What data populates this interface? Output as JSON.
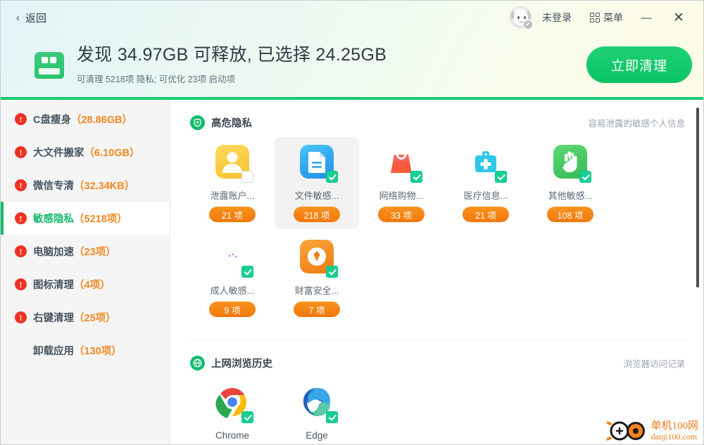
{
  "titlebar": {
    "back_chevron": "‹",
    "back_label": "返回",
    "login_label": "未登录",
    "menu_label": "菜单",
    "minimize_label": "—",
    "close_label": "✕",
    "avatar_badge": "✔"
  },
  "hero": {
    "title": "发现 34.97GB 可释放, 已选择 24.25GB",
    "subtitle": "可清理 5218项 隐私; 可优化 23项 启动项",
    "clean_button": "立即清理",
    "disk_icon": "disk-icon"
  },
  "colors": {
    "accent_green": "#19cb74",
    "badge_orange": "#f4780d",
    "warning_red": "#f03222",
    "sidebar_count": "#f5881f",
    "check_teal": "#18cf93"
  },
  "sidebar": {
    "items": [
      {
        "name": "C盘瘦身",
        "count": "（28.86GB）",
        "warn": true,
        "active": false
      },
      {
        "name": "大文件搬家",
        "count": "（6.10GB）",
        "warn": true,
        "active": false
      },
      {
        "name": "微信专清",
        "count": "（32.34KB）",
        "warn": true,
        "active": false
      },
      {
        "name": "敏感隐私",
        "count": "（5218项）",
        "warn": true,
        "active": true
      },
      {
        "name": "电脑加速",
        "count": "（23项）",
        "warn": true,
        "active": false
      },
      {
        "name": "图标清理",
        "count": "（4项）",
        "warn": true,
        "active": false
      },
      {
        "name": "右键清理",
        "count": "（25项）",
        "warn": true,
        "active": false
      },
      {
        "name": "卸载应用",
        "count": "（130项）",
        "warn": false,
        "active": false
      }
    ],
    "warn_glyph": "!"
  },
  "sections": [
    {
      "id": "high-risk-privacy",
      "icon": "shield-icon",
      "title": "高危隐私",
      "note": "容易泄露的敏感个人信息",
      "tiles": [
        {
          "label": "泄露账户...",
          "badge": "21 项",
          "checked": false,
          "highlighted": false,
          "icon": "account-leak-icon"
        },
        {
          "label": "文件敏感...",
          "badge": "218 项",
          "checked": true,
          "highlighted": true,
          "icon": "document-icon"
        },
        {
          "label": "网络购物...",
          "badge": "33 项",
          "checked": true,
          "highlighted": false,
          "icon": "shopping-bag-icon"
        },
        {
          "label": "医疗信息...",
          "badge": "21 项",
          "checked": true,
          "highlighted": false,
          "icon": "medical-kit-icon"
        },
        {
          "label": "其他敏感...",
          "badge": "108 项",
          "checked": true,
          "highlighted": false,
          "icon": "hand-icon"
        },
        {
          "label": "成人敏感...",
          "badge": "9 项",
          "checked": true,
          "highlighted": false,
          "icon": "adult-icon"
        },
        {
          "label": "财富安全...",
          "badge": "7 项",
          "checked": true,
          "highlighted": false,
          "icon": "wealth-icon"
        }
      ]
    },
    {
      "id": "browsing-history",
      "icon": "globe-icon",
      "title": "上网浏览历史",
      "note": "浏览器访问记录",
      "tiles": [
        {
          "label": "Chrome",
          "checked": true,
          "highlighted": false,
          "icon": "chrome-icon"
        },
        {
          "label": "Edge",
          "checked": true,
          "highlighted": false,
          "icon": "edge-icon"
        }
      ]
    }
  ],
  "watermark": {
    "line1": "单机100网",
    "line2": "danji100.com"
  }
}
